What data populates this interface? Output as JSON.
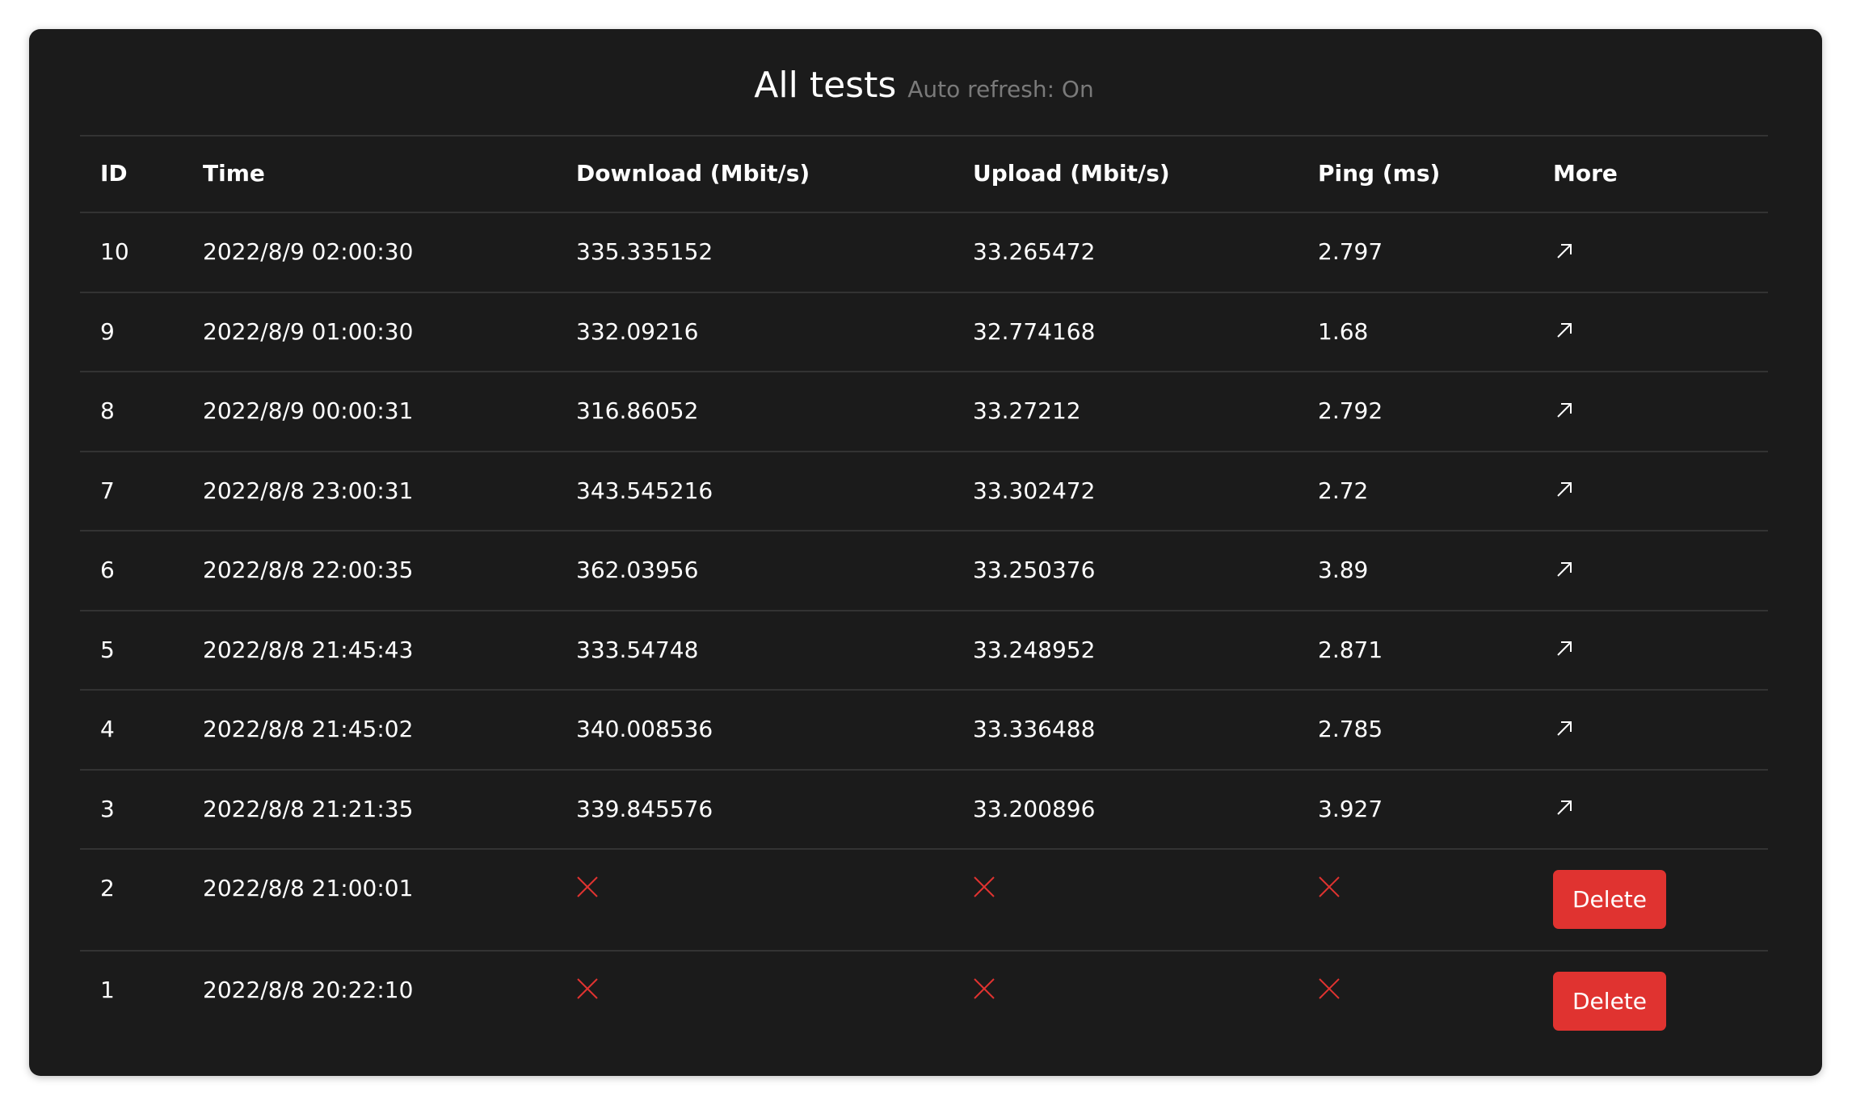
{
  "header": {
    "title": "All tests",
    "auto_refresh": "Auto refresh: On"
  },
  "colors": {
    "background": "#1b1b1b",
    "delete": "#e03330",
    "fail_icon": "#e03330"
  },
  "table": {
    "columns": [
      "ID",
      "Time",
      "Download (Mbit/s)",
      "Upload (Mbit/s)",
      "Ping (ms)",
      "More"
    ],
    "rows": [
      {
        "id": "10",
        "time": "2022/8/9 02:00:30",
        "download": "335.335152",
        "upload": "33.265472",
        "ping": "2.797",
        "more": "arrow-up-right-icon"
      },
      {
        "id": "9",
        "time": "2022/8/9 01:00:30",
        "download": "332.09216",
        "upload": "32.774168",
        "ping": "1.68",
        "more": "arrow-up-right-icon"
      },
      {
        "id": "8",
        "time": "2022/8/9 00:00:31",
        "download": "316.86052",
        "upload": "33.27212",
        "ping": "2.792",
        "more": "arrow-up-right-icon"
      },
      {
        "id": "7",
        "time": "2022/8/8 23:00:31",
        "download": "343.545216",
        "upload": "33.302472",
        "ping": "2.72",
        "more": "arrow-up-right-icon"
      },
      {
        "id": "6",
        "time": "2022/8/8 22:00:35",
        "download": "362.03956",
        "upload": "33.250376",
        "ping": "3.89",
        "more": "arrow-up-right-icon"
      },
      {
        "id": "5",
        "time": "2022/8/8 21:45:43",
        "download": "333.54748",
        "upload": "33.248952",
        "ping": "2.871",
        "more": "arrow-up-right-icon"
      },
      {
        "id": "4",
        "time": "2022/8/8 21:45:02",
        "download": "340.008536",
        "upload": "33.336488",
        "ping": "2.785",
        "more": "arrow-up-right-icon"
      },
      {
        "id": "3",
        "time": "2022/8/8 21:21:35",
        "download": "339.845576",
        "upload": "33.200896",
        "ping": "3.927",
        "more": "arrow-up-right-icon"
      },
      {
        "id": "2",
        "time": "2022/8/8 21:00:01",
        "failed": true,
        "more_label": "Delete"
      },
      {
        "id": "1",
        "time": "2022/8/8 20:22:10",
        "failed": true,
        "more_label": "Delete"
      }
    ]
  }
}
